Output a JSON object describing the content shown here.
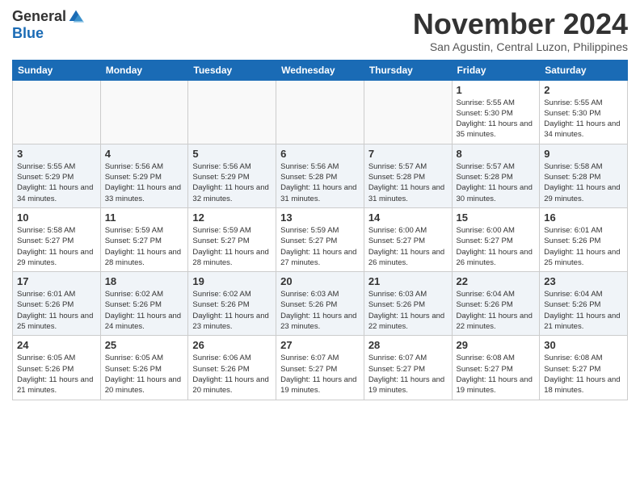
{
  "header": {
    "logo_general": "General",
    "logo_blue": "Blue",
    "month_title": "November 2024",
    "location": "San Agustin, Central Luzon, Philippines"
  },
  "weekdays": [
    "Sunday",
    "Monday",
    "Tuesday",
    "Wednesday",
    "Thursday",
    "Friday",
    "Saturday"
  ],
  "weeks": [
    [
      {
        "day": "",
        "sunrise": "",
        "sunset": "",
        "daylight": "",
        "empty": true
      },
      {
        "day": "",
        "sunrise": "",
        "sunset": "",
        "daylight": "",
        "empty": true
      },
      {
        "day": "",
        "sunrise": "",
        "sunset": "",
        "daylight": "",
        "empty": true
      },
      {
        "day": "",
        "sunrise": "",
        "sunset": "",
        "daylight": "",
        "empty": true
      },
      {
        "day": "",
        "sunrise": "",
        "sunset": "",
        "daylight": "",
        "empty": true
      },
      {
        "day": "1",
        "sunrise": "Sunrise: 5:55 AM",
        "sunset": "Sunset: 5:30 PM",
        "daylight": "Daylight: 11 hours and 35 minutes.",
        "empty": false
      },
      {
        "day": "2",
        "sunrise": "Sunrise: 5:55 AM",
        "sunset": "Sunset: 5:30 PM",
        "daylight": "Daylight: 11 hours and 34 minutes.",
        "empty": false
      }
    ],
    [
      {
        "day": "3",
        "sunrise": "Sunrise: 5:55 AM",
        "sunset": "Sunset: 5:29 PM",
        "daylight": "Daylight: 11 hours and 34 minutes.",
        "empty": false
      },
      {
        "day": "4",
        "sunrise": "Sunrise: 5:56 AM",
        "sunset": "Sunset: 5:29 PM",
        "daylight": "Daylight: 11 hours and 33 minutes.",
        "empty": false
      },
      {
        "day": "5",
        "sunrise": "Sunrise: 5:56 AM",
        "sunset": "Sunset: 5:29 PM",
        "daylight": "Daylight: 11 hours and 32 minutes.",
        "empty": false
      },
      {
        "day": "6",
        "sunrise": "Sunrise: 5:56 AM",
        "sunset": "Sunset: 5:28 PM",
        "daylight": "Daylight: 11 hours and 31 minutes.",
        "empty": false
      },
      {
        "day": "7",
        "sunrise": "Sunrise: 5:57 AM",
        "sunset": "Sunset: 5:28 PM",
        "daylight": "Daylight: 11 hours and 31 minutes.",
        "empty": false
      },
      {
        "day": "8",
        "sunrise": "Sunrise: 5:57 AM",
        "sunset": "Sunset: 5:28 PM",
        "daylight": "Daylight: 11 hours and 30 minutes.",
        "empty": false
      },
      {
        "day": "9",
        "sunrise": "Sunrise: 5:58 AM",
        "sunset": "Sunset: 5:28 PM",
        "daylight": "Daylight: 11 hours and 29 minutes.",
        "empty": false
      }
    ],
    [
      {
        "day": "10",
        "sunrise": "Sunrise: 5:58 AM",
        "sunset": "Sunset: 5:27 PM",
        "daylight": "Daylight: 11 hours and 29 minutes.",
        "empty": false
      },
      {
        "day": "11",
        "sunrise": "Sunrise: 5:59 AM",
        "sunset": "Sunset: 5:27 PM",
        "daylight": "Daylight: 11 hours and 28 minutes.",
        "empty": false
      },
      {
        "day": "12",
        "sunrise": "Sunrise: 5:59 AM",
        "sunset": "Sunset: 5:27 PM",
        "daylight": "Daylight: 11 hours and 28 minutes.",
        "empty": false
      },
      {
        "day": "13",
        "sunrise": "Sunrise: 5:59 AM",
        "sunset": "Sunset: 5:27 PM",
        "daylight": "Daylight: 11 hours and 27 minutes.",
        "empty": false
      },
      {
        "day": "14",
        "sunrise": "Sunrise: 6:00 AM",
        "sunset": "Sunset: 5:27 PM",
        "daylight": "Daylight: 11 hours and 26 minutes.",
        "empty": false
      },
      {
        "day": "15",
        "sunrise": "Sunrise: 6:00 AM",
        "sunset": "Sunset: 5:27 PM",
        "daylight": "Daylight: 11 hours and 26 minutes.",
        "empty": false
      },
      {
        "day": "16",
        "sunrise": "Sunrise: 6:01 AM",
        "sunset": "Sunset: 5:26 PM",
        "daylight": "Daylight: 11 hours and 25 minutes.",
        "empty": false
      }
    ],
    [
      {
        "day": "17",
        "sunrise": "Sunrise: 6:01 AM",
        "sunset": "Sunset: 5:26 PM",
        "daylight": "Daylight: 11 hours and 25 minutes.",
        "empty": false
      },
      {
        "day": "18",
        "sunrise": "Sunrise: 6:02 AM",
        "sunset": "Sunset: 5:26 PM",
        "daylight": "Daylight: 11 hours and 24 minutes.",
        "empty": false
      },
      {
        "day": "19",
        "sunrise": "Sunrise: 6:02 AM",
        "sunset": "Sunset: 5:26 PM",
        "daylight": "Daylight: 11 hours and 23 minutes.",
        "empty": false
      },
      {
        "day": "20",
        "sunrise": "Sunrise: 6:03 AM",
        "sunset": "Sunset: 5:26 PM",
        "daylight": "Daylight: 11 hours and 23 minutes.",
        "empty": false
      },
      {
        "day": "21",
        "sunrise": "Sunrise: 6:03 AM",
        "sunset": "Sunset: 5:26 PM",
        "daylight": "Daylight: 11 hours and 22 minutes.",
        "empty": false
      },
      {
        "day": "22",
        "sunrise": "Sunrise: 6:04 AM",
        "sunset": "Sunset: 5:26 PM",
        "daylight": "Daylight: 11 hours and 22 minutes.",
        "empty": false
      },
      {
        "day": "23",
        "sunrise": "Sunrise: 6:04 AM",
        "sunset": "Sunset: 5:26 PM",
        "daylight": "Daylight: 11 hours and 21 minutes.",
        "empty": false
      }
    ],
    [
      {
        "day": "24",
        "sunrise": "Sunrise: 6:05 AM",
        "sunset": "Sunset: 5:26 PM",
        "daylight": "Daylight: 11 hours and 21 minutes.",
        "empty": false
      },
      {
        "day": "25",
        "sunrise": "Sunrise: 6:05 AM",
        "sunset": "Sunset: 5:26 PM",
        "daylight": "Daylight: 11 hours and 20 minutes.",
        "empty": false
      },
      {
        "day": "26",
        "sunrise": "Sunrise: 6:06 AM",
        "sunset": "Sunset: 5:26 PM",
        "daylight": "Daylight: 11 hours and 20 minutes.",
        "empty": false
      },
      {
        "day": "27",
        "sunrise": "Sunrise: 6:07 AM",
        "sunset": "Sunset: 5:27 PM",
        "daylight": "Daylight: 11 hours and 19 minutes.",
        "empty": false
      },
      {
        "day": "28",
        "sunrise": "Sunrise: 6:07 AM",
        "sunset": "Sunset: 5:27 PM",
        "daylight": "Daylight: 11 hours and 19 minutes.",
        "empty": false
      },
      {
        "day": "29",
        "sunrise": "Sunrise: 6:08 AM",
        "sunset": "Sunset: 5:27 PM",
        "daylight": "Daylight: 11 hours and 19 minutes.",
        "empty": false
      },
      {
        "day": "30",
        "sunrise": "Sunrise: 6:08 AM",
        "sunset": "Sunset: 5:27 PM",
        "daylight": "Daylight: 11 hours and 18 minutes.",
        "empty": false
      }
    ]
  ]
}
